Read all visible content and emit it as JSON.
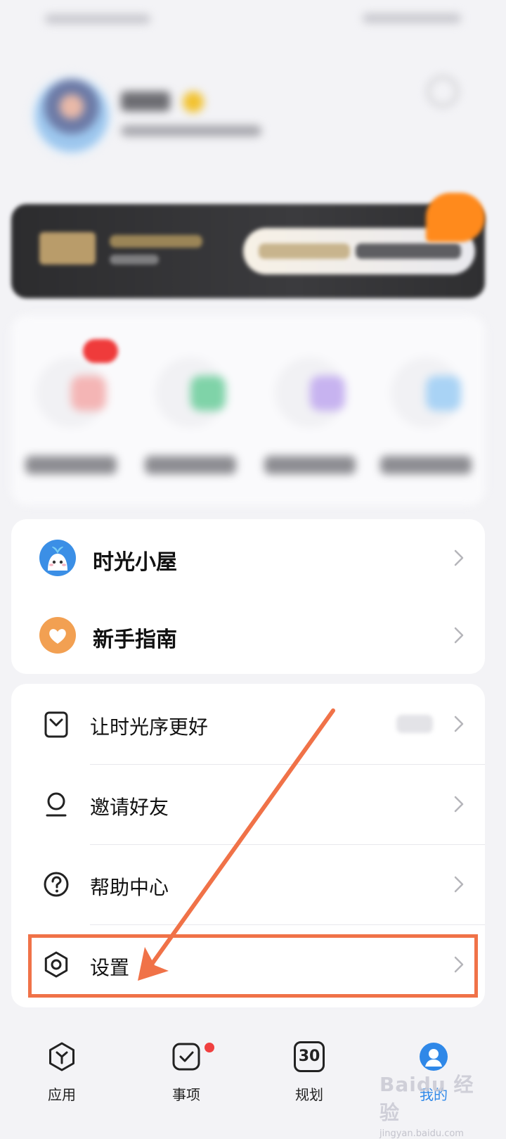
{
  "featured": {
    "items": [
      {
        "label": "时光小屋",
        "icon": "ghost-mascot-icon"
      },
      {
        "label": "新手指南",
        "icon": "heart-icon"
      }
    ]
  },
  "menu": {
    "items": [
      {
        "label": "让时光序更好",
        "icon": "feedback-icon"
      },
      {
        "label": "邀请好友",
        "icon": "user-icon"
      },
      {
        "label": "帮助中心",
        "icon": "help-icon"
      },
      {
        "label": "设置",
        "icon": "gear-icon"
      }
    ],
    "highlighted_item": "设置"
  },
  "bottom_nav": {
    "items": [
      {
        "label": "应用",
        "icon": "apps-hexagon-icon"
      },
      {
        "label": "事项",
        "icon": "checklist-icon"
      },
      {
        "label": "规划",
        "icon": "calendar-icon",
        "calendar_number": "30"
      },
      {
        "label": "我的",
        "icon": "avatar-icon"
      }
    ],
    "active": "我的"
  },
  "watermark": {
    "brand": "Baidu 经验",
    "url": "jingyan.baidu.com"
  },
  "colors": {
    "accent": "#2f88e8",
    "highlight": "#f07248",
    "badge": "#f04040",
    "vip_bg": "#2c2c2e",
    "heart": "#f2a052"
  }
}
